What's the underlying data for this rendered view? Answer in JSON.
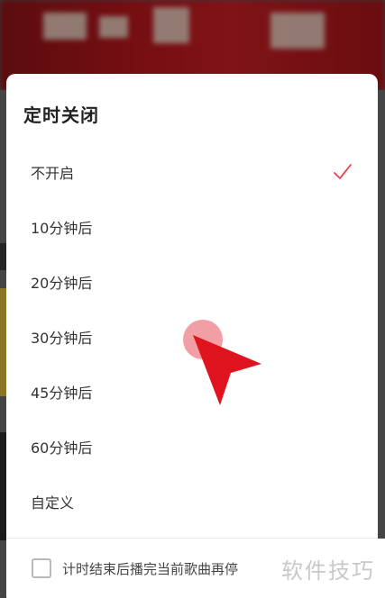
{
  "dialog": {
    "title": "定时关闭",
    "options": [
      {
        "label": "不开启",
        "selected": true
      },
      {
        "label": "10分钟后",
        "selected": false
      },
      {
        "label": "20分钟后",
        "selected": false
      },
      {
        "label": "30分钟后",
        "selected": false
      },
      {
        "label": "45分钟后",
        "selected": false
      },
      {
        "label": "60分钟后",
        "selected": false
      },
      {
        "label": "自定义",
        "selected": false
      }
    ],
    "footer_checkbox_label": "计时结束后播完当前歌曲再停",
    "footer_checkbox_checked": false
  },
  "watermark": "软件技巧",
  "colors": {
    "accent": "#e8444a",
    "banner": "#b5161d",
    "check": "#e8444a"
  },
  "icons": {
    "selected_marker": "check-icon",
    "pointer": "cursor-arrow-icon"
  }
}
